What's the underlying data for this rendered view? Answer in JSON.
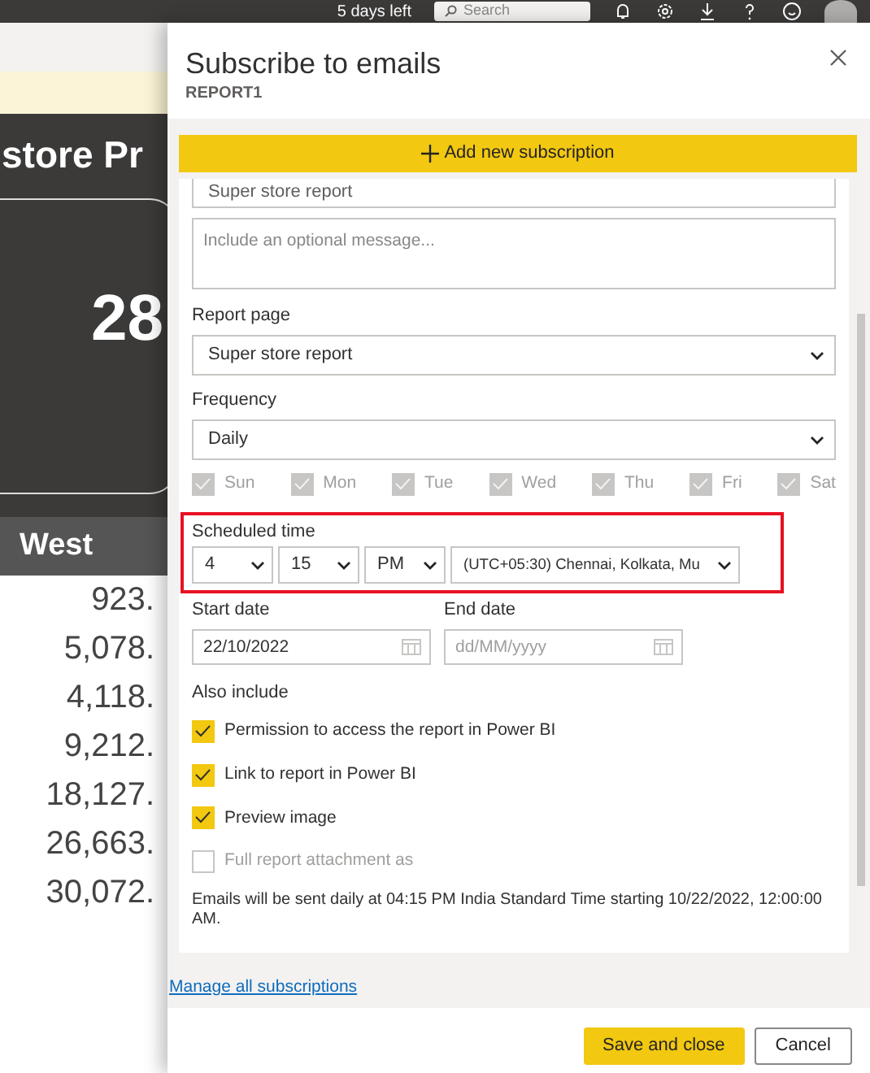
{
  "top_bar": {
    "trial": "5 days left",
    "search": {
      "placeholder": "Search"
    }
  },
  "report": {
    "title": "store Pr",
    "kpi_value": "28",
    "table": {
      "columns": [
        "West"
      ],
      "rows": [
        {
          "west": "923."
        },
        {
          "west": "5,078."
        },
        {
          "west": "4,118."
        },
        {
          "west": "9,212."
        },
        {
          "west": "18,127."
        },
        {
          "west": "26,663."
        },
        {
          "west": "30,072."
        }
      ]
    }
  },
  "dialog": {
    "title": "Subscribe to emails",
    "subtitle": "REPORT1",
    "add_button": "Add new subscription",
    "subject": {
      "value": "Super store report"
    },
    "message": {
      "placeholder": "Include an optional message..."
    },
    "report_page": {
      "label": "Report page",
      "value": "Super store report"
    },
    "frequency": {
      "label": "Frequency",
      "value": "Daily"
    },
    "days": [
      {
        "label": "Sun",
        "checked": true,
        "disabled": true
      },
      {
        "label": "Mon",
        "checked": true,
        "disabled": true
      },
      {
        "label": "Tue",
        "checked": true,
        "disabled": true
      },
      {
        "label": "Wed",
        "checked": true,
        "disabled": true
      },
      {
        "label": "Thu",
        "checked": true,
        "disabled": true
      },
      {
        "label": "Fri",
        "checked": true,
        "disabled": true
      },
      {
        "label": "Sat",
        "checked": true,
        "disabled": true
      }
    ],
    "scheduled_time": {
      "label": "Scheduled time",
      "highlighted": true,
      "hour": "4",
      "minute": "15",
      "period": "PM",
      "timezone": "(UTC+05:30) Chennai, Kolkata, Mu"
    },
    "start_date": {
      "label": "Start date",
      "value": "22/10/2022"
    },
    "end_date": {
      "label": "End date",
      "placeholder": "dd/MM/yyyy"
    },
    "also_include": {
      "label": "Also include",
      "options": [
        {
          "label": "Permission to access the report in Power BI",
          "checked": true,
          "disabled": false
        },
        {
          "label": "Link to report in Power BI",
          "checked": true,
          "disabled": false
        },
        {
          "label": "Preview image",
          "checked": true,
          "disabled": false
        },
        {
          "label": "Full report attachment as",
          "checked": false,
          "disabled": true
        }
      ]
    },
    "summary": "Emails will be sent daily at 04:15 PM India Standard Time starting 10/22/2022, 12:00:00 AM.",
    "manage_link": "Manage all subscriptions",
    "buttons": [
      {
        "label": "Save and close",
        "kind": "primary"
      },
      {
        "label": "Cancel",
        "kind": "secondary"
      }
    ]
  }
}
